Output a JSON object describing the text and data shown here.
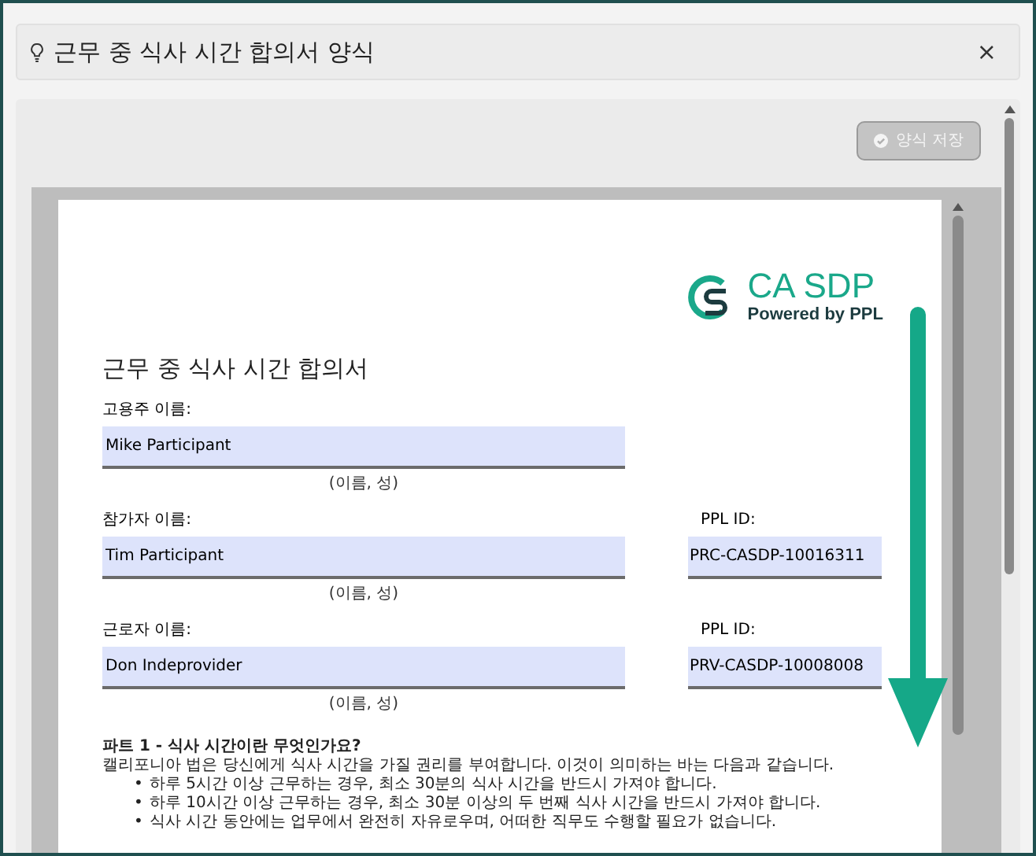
{
  "window": {
    "title": "근무 중 식사 시간 합의서 양식",
    "close": "×"
  },
  "save_button": {
    "label": "양식 저장",
    "disabled": true
  },
  "document": {
    "logo": {
      "name": "CA SDP",
      "tagline": "Powered by PPL"
    },
    "title": "근무 중 식사 시간 합의서",
    "fields": [
      {
        "label": "고용주 이름:",
        "value": "Mike Participant",
        "hint": "(이름, 성)"
      },
      {
        "label": "참가자 이름:",
        "value": "Tim Participant",
        "hint": "(이름, 성)",
        "id_label": "PPL ID:",
        "id_value": "PRC-CASDP-10016311"
      },
      {
        "label": "근로자 이름:",
        "value": "Don Indeprovider",
        "hint": "(이름, 성)",
        "id_label": "PPL ID:",
        "id_value": "PRV-CASDP-10008008"
      }
    ],
    "section_heading": "파트 1 - 식사 시간이란 무엇인가요?",
    "paragraph": "캘리포니아 법은 당신에게 식사 시간을 가질 권리를 부여합니다. 이것이 의미하는 바는 다음과 같습니다.",
    "bullet_mark": "•",
    "bullets": [
      "하루 5시간 이상 근무하는 경우, 최소 30분의 식사 시간을 반드시 가져야 합니다.",
      "하루 10시간 이상 근무하는 경우, 최소 30분 이상의 두 번째 식사 시간을 반드시 가져야 합니다.",
      "식사 시간 동안에는 업무에서 완전히 자유로우며, 어떠한 직무도 수행할 필요가 없습니다."
    ]
  }
}
